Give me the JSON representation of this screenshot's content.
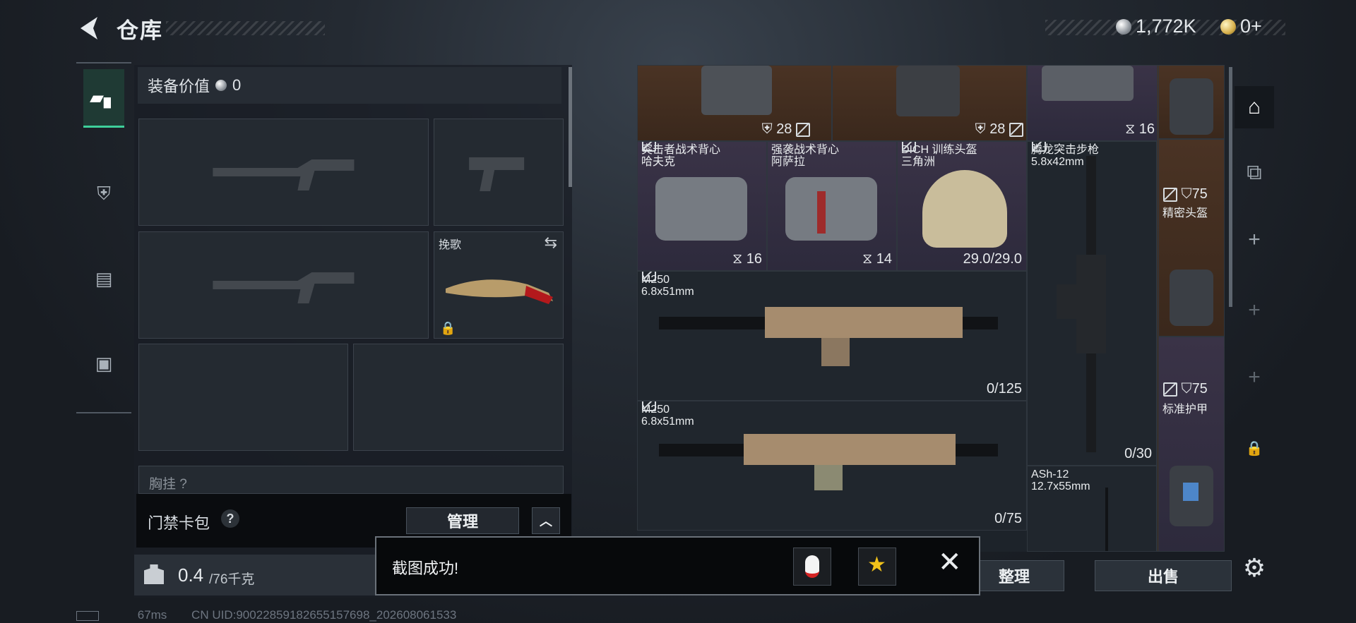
{
  "header": {
    "title": "仓库",
    "currency_silver": "1,772K",
    "currency_gold": "0+"
  },
  "equipment": {
    "value_label": "装备价值",
    "value": "0",
    "knife_name": "挽歌",
    "partial_label": "胸挂 ?"
  },
  "access": {
    "label": "门禁卡包",
    "help": "?",
    "manage": "管理"
  },
  "weight": {
    "current": "0.4",
    "max": "/76千克"
  },
  "grid": {
    "row0": [
      {
        "count": "28"
      },
      {
        "count": "28"
      },
      {
        "count": "16"
      }
    ],
    "items": [
      {
        "name": "突击者战术背心\n哈夫克",
        "stat": "16"
      },
      {
        "name": "强袭战术背心\n阿萨拉",
        "stat": "14"
      },
      {
        "name": "DICH 训练头盔\n三角洲",
        "stat": "29.0/29.0"
      },
      {
        "name": "腾龙突击步枪\n5.8x42mm",
        "stat": "0/30"
      },
      {
        "name": "M250\n6.8x51mm",
        "stat": "0/125"
      },
      {
        "name": "M250\n6.8x51mm",
        "stat": "0/75"
      },
      {
        "name": "ASh-12\n12.7x55mm",
        "stat": ""
      }
    ],
    "side": [
      {
        "stat": "75",
        "name": "精密头盔"
      },
      {
        "stat": "75",
        "name": "标准护甲"
      }
    ]
  },
  "actions": {
    "sort": "整理",
    "sell": "出售"
  },
  "toast": {
    "message": "截图成功!"
  },
  "status": {
    "ping": "67ms",
    "uid": "CN UID:900228591826551576​98_202608061533"
  },
  "colors": {
    "accent": "#3ecf9a",
    "purple_rarity": "#3a3347",
    "gold_rarity": "#4a3324"
  }
}
